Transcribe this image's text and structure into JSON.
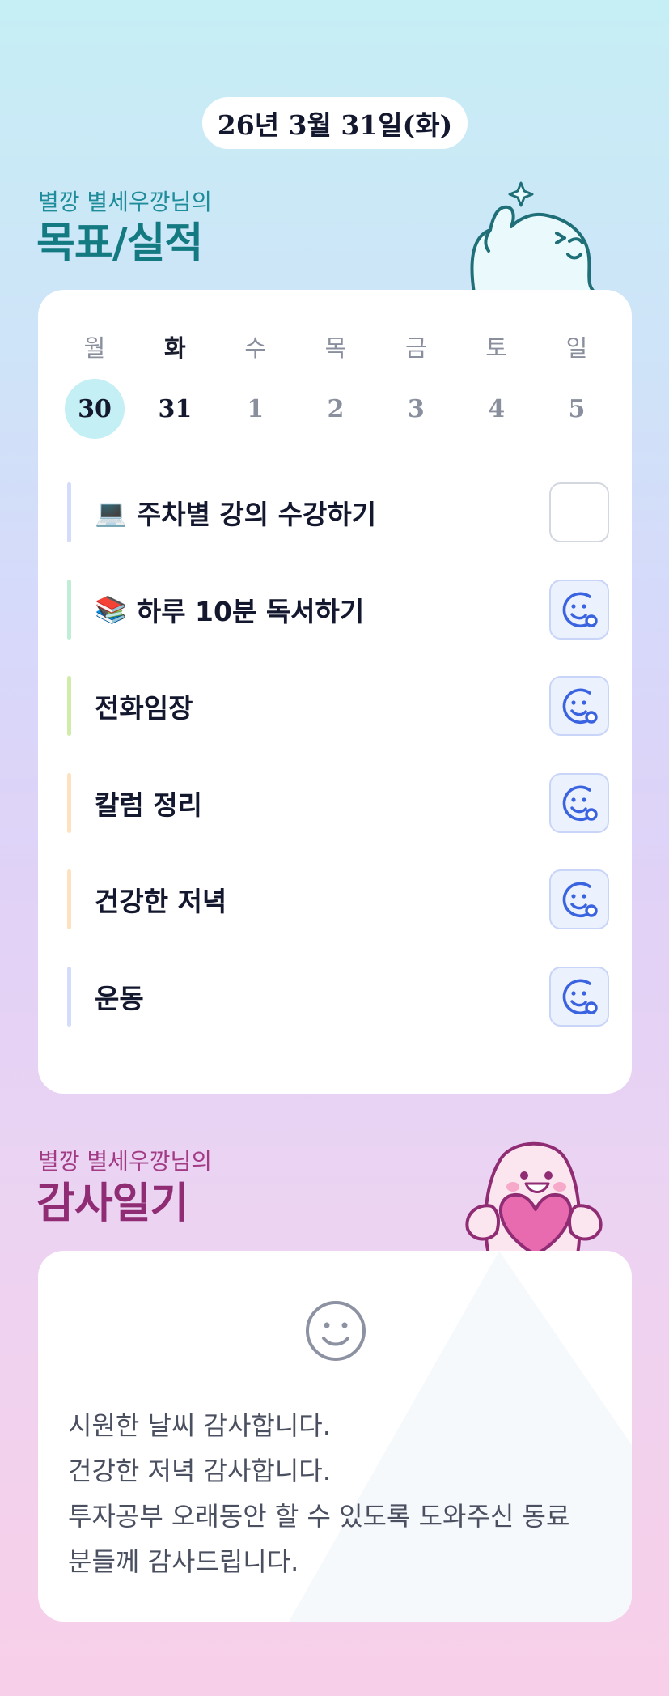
{
  "date_label": "26년 3월 31일(화)",
  "goals_section": {
    "subtitle": "별깡 별세우깡님의",
    "title": "목표/실적"
  },
  "week": {
    "days": [
      {
        "name": "월",
        "date": "30",
        "state": "selected"
      },
      {
        "name": "화",
        "date": "31",
        "state": "today"
      },
      {
        "name": "수",
        "date": "1",
        "state": "future"
      },
      {
        "name": "목",
        "date": "2",
        "state": "future"
      },
      {
        "name": "금",
        "date": "3",
        "state": "future"
      },
      {
        "name": "토",
        "date": "4",
        "state": "future"
      },
      {
        "name": "일",
        "date": "5",
        "state": "future"
      }
    ]
  },
  "goals": [
    {
      "emoji": "💻",
      "label": "주차별 강의 수강하기",
      "done": false,
      "bar_color": "#d3dcfa"
    },
    {
      "emoji": "📚",
      "label": "하루 10분 독서하기",
      "done": true,
      "bar_color": "#bfeed4"
    },
    {
      "emoji": "",
      "label": "전화임장",
      "done": true,
      "bar_color": "#cfeca8"
    },
    {
      "emoji": "",
      "label": "칼럼 정리",
      "done": true,
      "bar_color": "#fde2bd"
    },
    {
      "emoji": "",
      "label": "건강한 저녁",
      "done": true,
      "bar_color": "#fde2bd"
    },
    {
      "emoji": "",
      "label": "운동",
      "done": true,
      "bar_color": "#d3dcfa"
    }
  ],
  "gratitude_section": {
    "subtitle": "별깡 별세우깡님의",
    "title": "감사일기"
  },
  "gratitude": {
    "icon": "smile-face-icon",
    "lines": [
      "시원한 날씨 감사합니다.",
      "건강한 저녁 감사합니다.",
      "투자공부 오래동안 할 수 있도록 도와주신 동료",
      "분들께 감사드립니다."
    ]
  },
  "colors": {
    "goal_title": "#147a82",
    "gratitude_title": "#8f2c73",
    "check_accent": "#3a63e0",
    "selected_day": "#c3eff5"
  }
}
